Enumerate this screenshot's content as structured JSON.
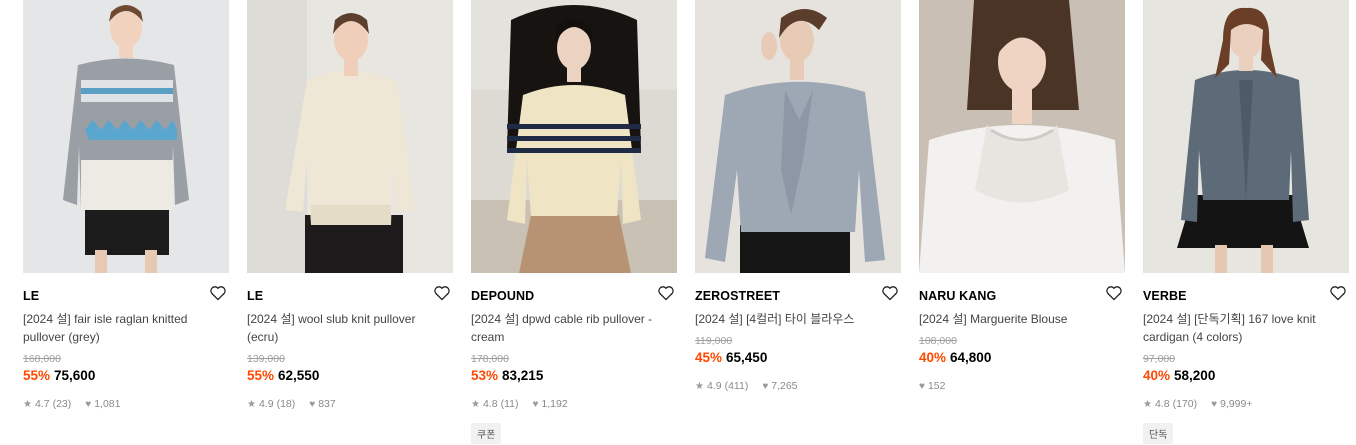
{
  "products": [
    {
      "brand": "LE",
      "title": "[2024 설] fair isle raglan knitted pullover (grey)",
      "original_price": "168,000",
      "discount": "55%",
      "price": "75,600",
      "rating": "4.7",
      "reviews": "(23)",
      "likes": "1,081",
      "badge": ""
    },
    {
      "brand": "LE",
      "title": "[2024 설] wool slub knit pullover (ecru)",
      "original_price": "139,000",
      "discount": "55%",
      "price": "62,550",
      "rating": "4.9",
      "reviews": "(18)",
      "likes": "837",
      "badge": ""
    },
    {
      "brand": "DEPOUND",
      "title": "[2024 설] dpwd cable rib pullover - cream",
      "original_price": "178,000",
      "discount": "53%",
      "price": "83,215",
      "rating": "4.8",
      "reviews": "(11)",
      "likes": "1,192",
      "badge": "쿠폰"
    },
    {
      "brand": "ZEROSTREET",
      "title": "[2024 설] [4컬러] 타이 블라우스",
      "original_price": "119,000",
      "discount": "45%",
      "price": "65,450",
      "rating": "4.9",
      "reviews": "(411)",
      "likes": "7,265",
      "badge": ""
    },
    {
      "brand": "NARU KANG",
      "title": "[2024 설] Marguerite Blouse",
      "original_price": "108,000",
      "discount": "40%",
      "price": "64,800",
      "rating": "",
      "reviews": "",
      "likes": "152",
      "badge": ""
    },
    {
      "brand": "VERBE",
      "title": "[2024 설] [단독기획] 167 love knit cardigan (4 colors)",
      "original_price": "97,000",
      "discount": "40%",
      "price": "58,200",
      "rating": "4.8",
      "reviews": "(170)",
      "likes": "9,999+",
      "badge": "단독"
    }
  ],
  "icons": {
    "wishlist": "heart-outline-icon",
    "rating": "star-icon",
    "likes": "heart-filled-icon"
  },
  "colors": {
    "discount": "#ff4800",
    "strikethrough": "#a0a0a0",
    "meta": "#8a8a8a"
  }
}
